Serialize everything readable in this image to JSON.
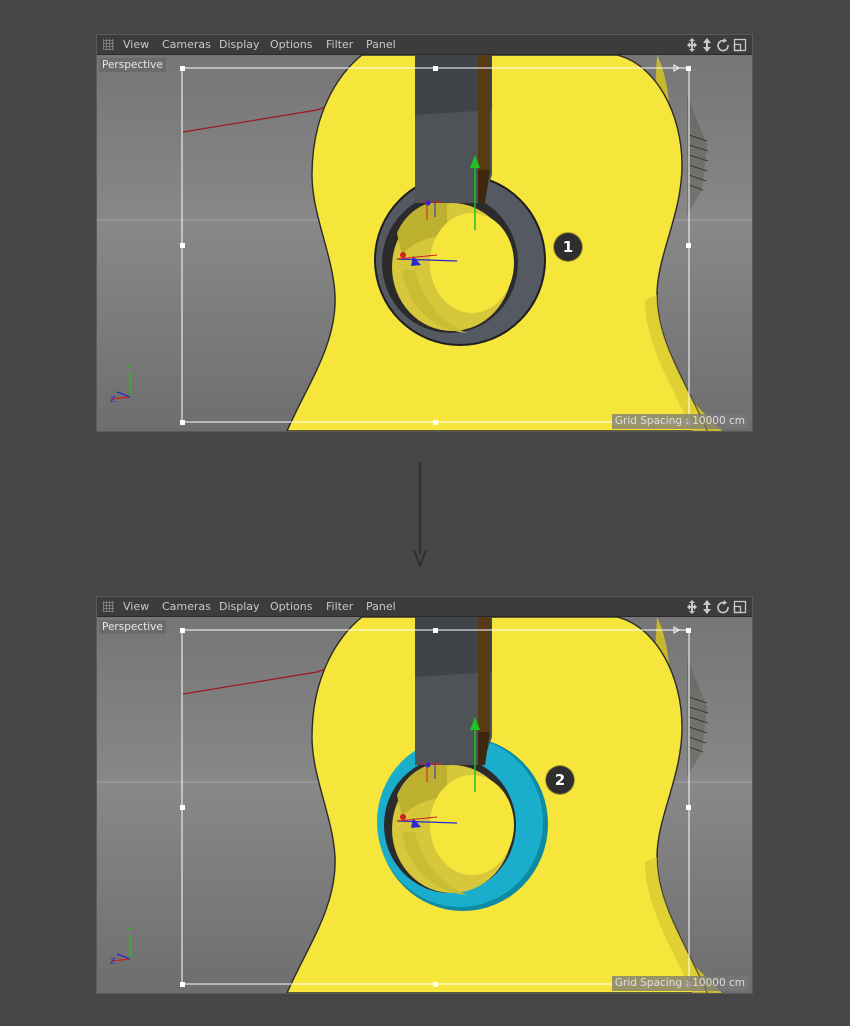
{
  "menu": {
    "items": [
      "View",
      "Cameras",
      "Display",
      "Options",
      "Filter",
      "Panel"
    ]
  },
  "viewports": [
    {
      "label": "Perspective",
      "grid_spacing": "Grid Spacing : 10000 cm",
      "step": "1",
      "ring_color": "#555a62"
    },
    {
      "label": "Perspective",
      "grid_spacing": "Grid Spacing : 10000 cm",
      "step": "2",
      "ring_color": "#1aaecc"
    }
  ],
  "colors": {
    "guitar_body": "#f6e53b",
    "neck": "#4e5358",
    "fretboard": "#5a3a14",
    "background": "#464646"
  },
  "icons": [
    "move-icon",
    "zoom-icon",
    "rotate-icon",
    "maximize-icon",
    "arrow-down-icon"
  ]
}
